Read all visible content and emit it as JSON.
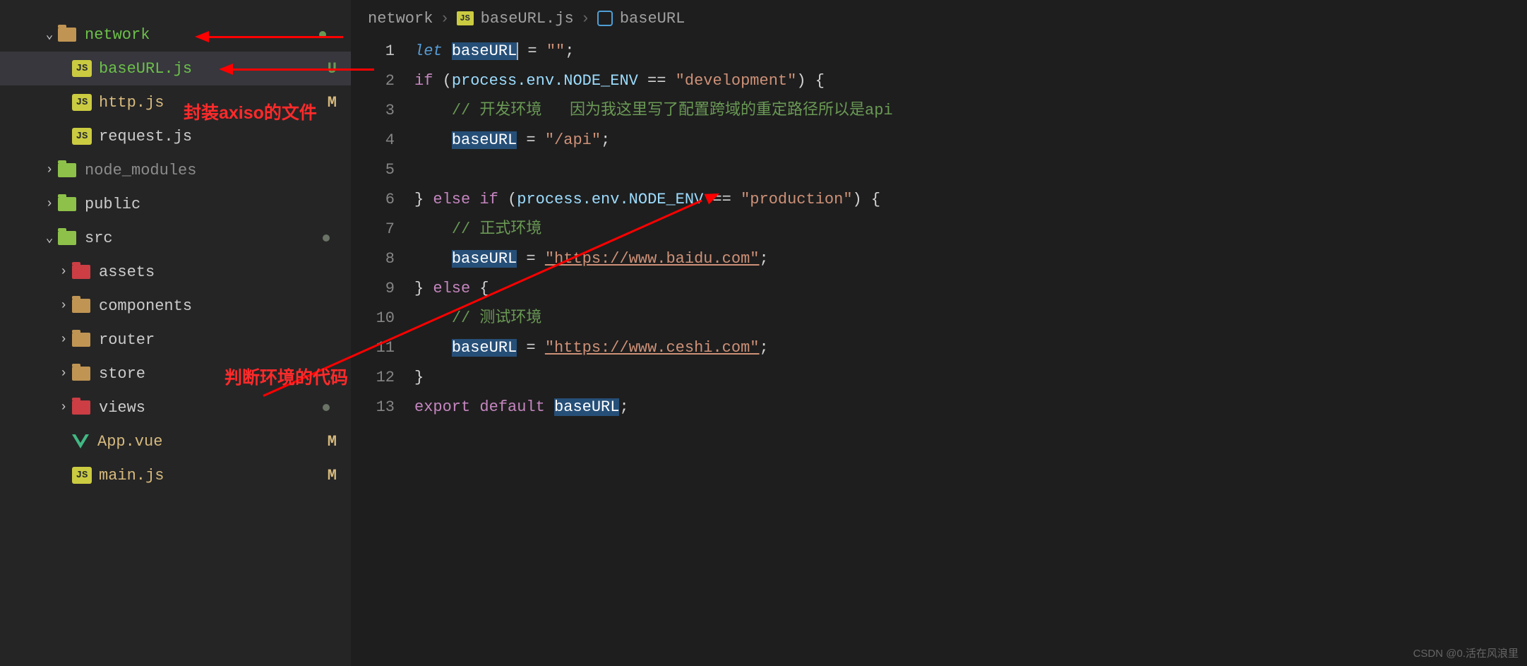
{
  "sidebar": {
    "items": [
      {
        "label": "network",
        "icon": "folder-open",
        "color": "green",
        "chevron": "down",
        "indent": 58,
        "status_dot": true
      },
      {
        "label": "baseURL.js",
        "icon": "js",
        "color": "green",
        "indent": 102,
        "status": "U",
        "selected": true
      },
      {
        "label": "http.js",
        "icon": "js",
        "color": "yellow",
        "indent": 102,
        "status": "M"
      },
      {
        "label": "request.js",
        "icon": "js",
        "color": "",
        "indent": 102
      },
      {
        "label": "node_modules",
        "icon": "folder-node",
        "color": "gray",
        "chevron": "right",
        "indent": 58
      },
      {
        "label": "public",
        "icon": "folder-public",
        "color": "",
        "chevron": "right",
        "indent": 58
      },
      {
        "label": "src",
        "icon": "folder-src",
        "color": "",
        "chevron": "down",
        "indent": 58,
        "dot": true
      },
      {
        "label": "assets",
        "icon": "folder-assets",
        "color": "",
        "chevron": "right",
        "indent": 78
      },
      {
        "label": "components",
        "icon": "folder-comp",
        "color": "",
        "chevron": "right",
        "indent": 78
      },
      {
        "label": "router",
        "icon": "folder",
        "color": "",
        "chevron": "right",
        "indent": 78
      },
      {
        "label": "store",
        "icon": "folder",
        "color": "",
        "chevron": "right",
        "indent": 78
      },
      {
        "label": "views",
        "icon": "folder-views",
        "color": "",
        "chevron": "right",
        "indent": 78,
        "dot": true
      },
      {
        "label": "App.vue",
        "icon": "vue",
        "color": "yellow",
        "indent": 102,
        "status": "M"
      },
      {
        "label": "main.js",
        "icon": "js",
        "color": "yellow",
        "indent": 102,
        "status": "M"
      }
    ]
  },
  "breadcrumb": {
    "seg1": "network",
    "seg2": "baseURL.js",
    "seg3": "baseURL"
  },
  "code": {
    "lines": [
      "1",
      "2",
      "3",
      "4",
      "5",
      "6",
      "7",
      "8",
      "9",
      "10",
      "11",
      "12",
      "13"
    ],
    "tokens": {
      "let": "let",
      "baseURL": "baseURL",
      "eq": " = ",
      "empty_str": "\"\"",
      "semi": ";",
      "if": "if",
      "lp": " (",
      "process_env": "process.env.NODE_ENV",
      "eqeq": " == ",
      "dev": "\"development\"",
      "rp_brace": ") {",
      "comment_dev": "// 开发环境   因为我这里写了配置跨域的重定路径所以是api",
      "api": "\"/api\"",
      "rbrace": "}",
      "else_if": " else if",
      "prod": "\"production\"",
      "comment_prod": "// 正式环境",
      "url1": "\"https://www.baidu.com\"",
      "else": " else",
      "lbrace": " {",
      "comment_test": "// 测试环境",
      "url2": "\"https://www.ceshi.com\"",
      "export": "export",
      "default": "default"
    }
  },
  "annotations": {
    "a1": "封装axiso的文件",
    "a2": "判断环境的代码"
  },
  "watermark": "CSDN @0.活在风浪里"
}
